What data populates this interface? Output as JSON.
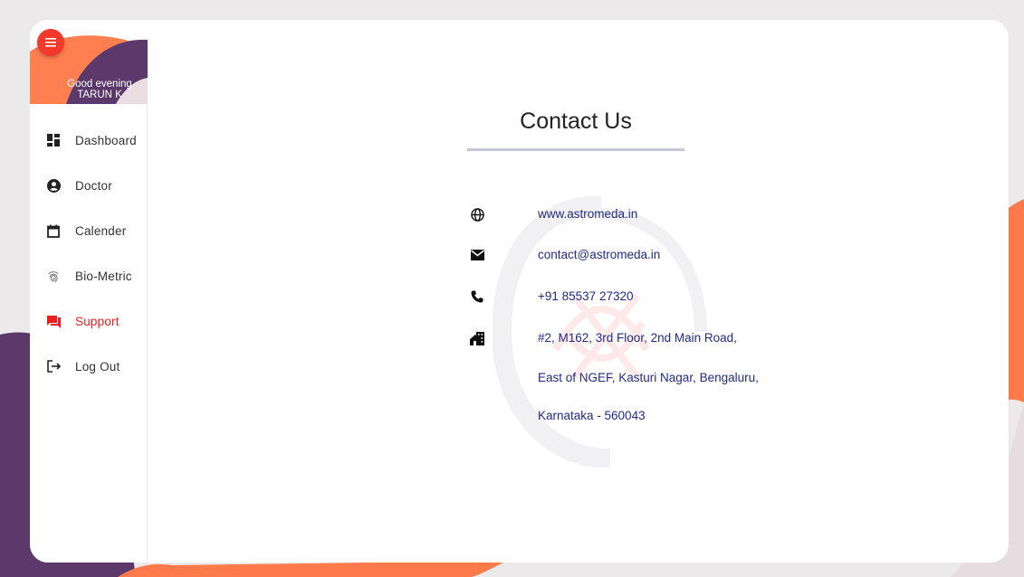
{
  "sidebar": {
    "greeting_line1": "Good evening",
    "greeting_line2": "TARUN K",
    "items": [
      {
        "label": "Dashboard",
        "icon": "dashboard-icon",
        "active": false
      },
      {
        "label": "Doctor",
        "icon": "account-circle-icon",
        "active": false
      },
      {
        "label": "Calender",
        "icon": "calendar-icon",
        "active": false
      },
      {
        "label": "Bio-Metric",
        "icon": "fingerprint-icon",
        "active": false
      },
      {
        "label": "Support",
        "icon": "chat-bubble-icon",
        "active": true
      },
      {
        "label": "Log Out",
        "icon": "logout-icon",
        "active": false
      }
    ]
  },
  "main": {
    "title": "Contact Us",
    "contacts": [
      {
        "icon": "globe-icon",
        "text": "www.astromeda.in"
      },
      {
        "icon": "mail-icon",
        "text": "contact@astromeda.in"
      },
      {
        "icon": "phone-icon",
        "text": "+91 85537 27320"
      },
      {
        "icon": "home-city-icon",
        "lines": [
          "#2, M162, 3rd Floor, 2nd Main Road,",
          "East of NGEF, Kasturi Nagar, Bengaluru,",
          "Karnataka - 560043"
        ]
      }
    ]
  },
  "colors": {
    "accent_red": "#ee1c1c",
    "menu_button": "#f2392c",
    "link_text": "#232a88",
    "purple": "#5b3a6b",
    "orange": "#ff7a4a"
  }
}
